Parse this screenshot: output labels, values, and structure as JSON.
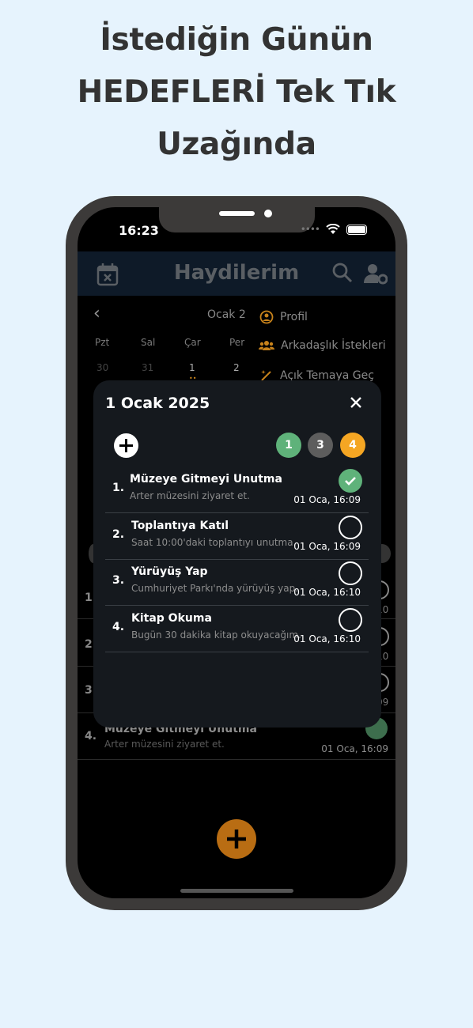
{
  "headline": {
    "line1": "İstediğin Günün",
    "line2": "HEDEFLERİ Tek Tık",
    "line3": "Uzağında"
  },
  "status_bar": {
    "time": "16:23"
  },
  "app": {
    "title": "Haydilerim"
  },
  "calendar": {
    "month_label": "Ocak 2",
    "weekdays": [
      "Pzt",
      "Sal",
      "Çar",
      "Per"
    ],
    "days": [
      "30",
      "31",
      "1",
      "2"
    ]
  },
  "menu": {
    "profile": "Profil",
    "friend_requests": "Arkadaşlık İstekleri",
    "light_theme": "Açık Temaya Geç"
  },
  "modal": {
    "title": "1 Ocak 2025",
    "badges": [
      {
        "value": "1",
        "color": "#5fb27a"
      },
      {
        "value": "3",
        "color": "#5d5d5d"
      },
      {
        "value": "4",
        "color": "#f5a623"
      }
    ],
    "tasks": [
      {
        "num": "1.",
        "title": "Müzeye Gitmeyi Unutma",
        "desc": "Arter müzesini ziyaret et.",
        "time": "01 Oca, 16:09",
        "done": true
      },
      {
        "num": "2.",
        "title": "Toplantıya Katıl",
        "desc": "Saat 10:00'daki toplantıyı unutma.",
        "time": "01 Oca, 16:09",
        "done": false
      },
      {
        "num": "3.",
        "title": "Yürüyüş Yap",
        "desc": "Cumhuriyet Parkı'nda yürüyüş yap.",
        "time": "01 Oca, 16:10",
        "done": false
      },
      {
        "num": "4.",
        "title": "Kitap Okuma",
        "desc": "Bugün 30 dakika kitap okuyacağım.",
        "time": "01 Oca, 16:10",
        "done": false
      }
    ]
  },
  "background_list": {
    "row4": {
      "num": "4.",
      "title": "Müzeye Gitmeyi Unutma",
      "desc": "Arter müzesini ziyaret et.",
      "time": "01 Oca, 16:09"
    },
    "nums": [
      "1.",
      "2.",
      "3."
    ],
    "time_fragments": [
      "10",
      "10",
      "09"
    ]
  },
  "colors": {
    "accent": "#f5a623",
    "done": "#5fb27a",
    "fab": "#b96d13"
  }
}
